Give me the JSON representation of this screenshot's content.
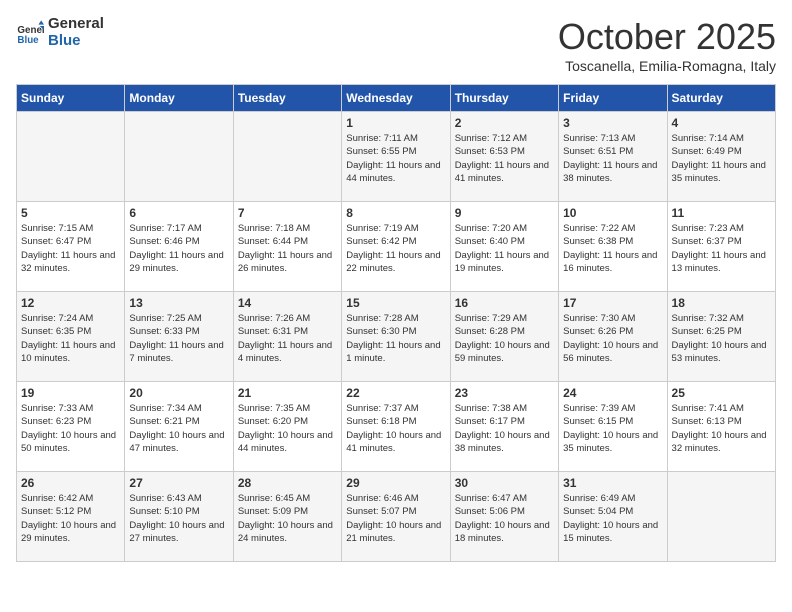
{
  "header": {
    "logo_general": "General",
    "logo_blue": "Blue",
    "month": "October 2025",
    "location": "Toscanella, Emilia-Romagna, Italy"
  },
  "days_of_week": [
    "Sunday",
    "Monday",
    "Tuesday",
    "Wednesday",
    "Thursday",
    "Friday",
    "Saturday"
  ],
  "weeks": [
    [
      {
        "day": "",
        "info": ""
      },
      {
        "day": "",
        "info": ""
      },
      {
        "day": "",
        "info": ""
      },
      {
        "day": "1",
        "info": "Sunrise: 7:11 AM\nSunset: 6:55 PM\nDaylight: 11 hours and 44 minutes."
      },
      {
        "day": "2",
        "info": "Sunrise: 7:12 AM\nSunset: 6:53 PM\nDaylight: 11 hours and 41 minutes."
      },
      {
        "day": "3",
        "info": "Sunrise: 7:13 AM\nSunset: 6:51 PM\nDaylight: 11 hours and 38 minutes."
      },
      {
        "day": "4",
        "info": "Sunrise: 7:14 AM\nSunset: 6:49 PM\nDaylight: 11 hours and 35 minutes."
      }
    ],
    [
      {
        "day": "5",
        "info": "Sunrise: 7:15 AM\nSunset: 6:47 PM\nDaylight: 11 hours and 32 minutes."
      },
      {
        "day": "6",
        "info": "Sunrise: 7:17 AM\nSunset: 6:46 PM\nDaylight: 11 hours and 29 minutes."
      },
      {
        "day": "7",
        "info": "Sunrise: 7:18 AM\nSunset: 6:44 PM\nDaylight: 11 hours and 26 minutes."
      },
      {
        "day": "8",
        "info": "Sunrise: 7:19 AM\nSunset: 6:42 PM\nDaylight: 11 hours and 22 minutes."
      },
      {
        "day": "9",
        "info": "Sunrise: 7:20 AM\nSunset: 6:40 PM\nDaylight: 11 hours and 19 minutes."
      },
      {
        "day": "10",
        "info": "Sunrise: 7:22 AM\nSunset: 6:38 PM\nDaylight: 11 hours and 16 minutes."
      },
      {
        "day": "11",
        "info": "Sunrise: 7:23 AM\nSunset: 6:37 PM\nDaylight: 11 hours and 13 minutes."
      }
    ],
    [
      {
        "day": "12",
        "info": "Sunrise: 7:24 AM\nSunset: 6:35 PM\nDaylight: 11 hours and 10 minutes."
      },
      {
        "day": "13",
        "info": "Sunrise: 7:25 AM\nSunset: 6:33 PM\nDaylight: 11 hours and 7 minutes."
      },
      {
        "day": "14",
        "info": "Sunrise: 7:26 AM\nSunset: 6:31 PM\nDaylight: 11 hours and 4 minutes."
      },
      {
        "day": "15",
        "info": "Sunrise: 7:28 AM\nSunset: 6:30 PM\nDaylight: 11 hours and 1 minute."
      },
      {
        "day": "16",
        "info": "Sunrise: 7:29 AM\nSunset: 6:28 PM\nDaylight: 10 hours and 59 minutes."
      },
      {
        "day": "17",
        "info": "Sunrise: 7:30 AM\nSunset: 6:26 PM\nDaylight: 10 hours and 56 minutes."
      },
      {
        "day": "18",
        "info": "Sunrise: 7:32 AM\nSunset: 6:25 PM\nDaylight: 10 hours and 53 minutes."
      }
    ],
    [
      {
        "day": "19",
        "info": "Sunrise: 7:33 AM\nSunset: 6:23 PM\nDaylight: 10 hours and 50 minutes."
      },
      {
        "day": "20",
        "info": "Sunrise: 7:34 AM\nSunset: 6:21 PM\nDaylight: 10 hours and 47 minutes."
      },
      {
        "day": "21",
        "info": "Sunrise: 7:35 AM\nSunset: 6:20 PM\nDaylight: 10 hours and 44 minutes."
      },
      {
        "day": "22",
        "info": "Sunrise: 7:37 AM\nSunset: 6:18 PM\nDaylight: 10 hours and 41 minutes."
      },
      {
        "day": "23",
        "info": "Sunrise: 7:38 AM\nSunset: 6:17 PM\nDaylight: 10 hours and 38 minutes."
      },
      {
        "day": "24",
        "info": "Sunrise: 7:39 AM\nSunset: 6:15 PM\nDaylight: 10 hours and 35 minutes."
      },
      {
        "day": "25",
        "info": "Sunrise: 7:41 AM\nSunset: 6:13 PM\nDaylight: 10 hours and 32 minutes."
      }
    ],
    [
      {
        "day": "26",
        "info": "Sunrise: 6:42 AM\nSunset: 5:12 PM\nDaylight: 10 hours and 29 minutes."
      },
      {
        "day": "27",
        "info": "Sunrise: 6:43 AM\nSunset: 5:10 PM\nDaylight: 10 hours and 27 minutes."
      },
      {
        "day": "28",
        "info": "Sunrise: 6:45 AM\nSunset: 5:09 PM\nDaylight: 10 hours and 24 minutes."
      },
      {
        "day": "29",
        "info": "Sunrise: 6:46 AM\nSunset: 5:07 PM\nDaylight: 10 hours and 21 minutes."
      },
      {
        "day": "30",
        "info": "Sunrise: 6:47 AM\nSunset: 5:06 PM\nDaylight: 10 hours and 18 minutes."
      },
      {
        "day": "31",
        "info": "Sunrise: 6:49 AM\nSunset: 5:04 PM\nDaylight: 10 hours and 15 minutes."
      },
      {
        "day": "",
        "info": ""
      }
    ]
  ]
}
